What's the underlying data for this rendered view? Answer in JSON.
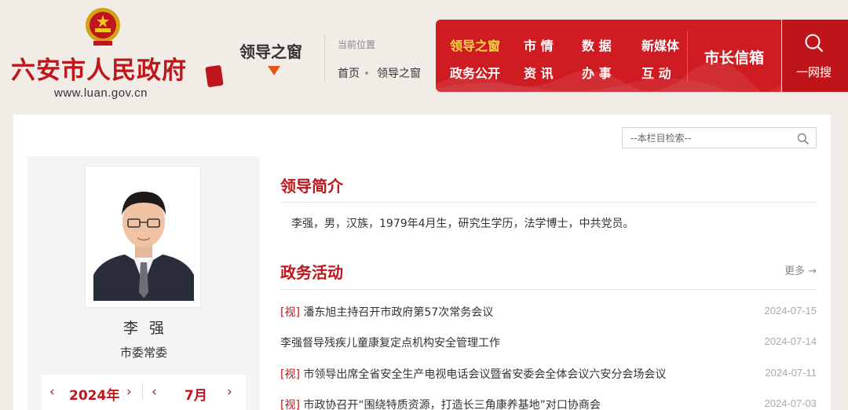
{
  "header": {
    "site_title": "六安市人民政府",
    "site_url": "www.luan.gov.cn",
    "section_name": "领导之窗",
    "current_position_label": "当前位置",
    "breadcrumb": {
      "home": "首页",
      "current": "领导之窗"
    }
  },
  "nav": {
    "items": [
      {
        "label": "领导之窗",
        "active": true
      },
      {
        "label": "市 情",
        "active": false
      },
      {
        "label": "数 据",
        "active": false
      },
      {
        "label": "新媒体",
        "active": false
      },
      {
        "label": "政务公开",
        "active": false
      },
      {
        "label": "资 讯",
        "active": false
      },
      {
        "label": "办 事",
        "active": false
      },
      {
        "label": "互 动",
        "active": false
      }
    ],
    "mayor_mailbox": "市长信箱",
    "search_label": "一网搜"
  },
  "column_search": {
    "placeholder": "--本栏目检索--"
  },
  "leader": {
    "name": "李强",
    "title": "市委常委"
  },
  "calendar": {
    "year": "2024年",
    "month": "7月"
  },
  "profile": {
    "heading": "领导简介",
    "text": "李强，男，汉族，1979年4月生，研究生学历，法学博士，中共党员。"
  },
  "activities": {
    "heading": "政务活动",
    "more": "更多",
    "items": [
      {
        "tag": "[视]",
        "title": "潘东旭主持召开市政府第57次常务会议",
        "date": "2024-07-15"
      },
      {
        "tag": "",
        "title": "李强督导残疾儿童康复定点机构安全管理工作",
        "date": "2024-07-14"
      },
      {
        "tag": "[视]",
        "title": "市领导出席全省安全生产电视电话会议暨省安委会全体会议六安分会场会议",
        "date": "2024-07-11"
      },
      {
        "tag": "[视]",
        "title": "市政协召开“围绕特质资源，打造长三角康养基地”对口协商会",
        "date": "2024-07-03"
      }
    ]
  },
  "colors": {
    "brand_red": "#c0151a",
    "nav_red": "#cf1c22",
    "active_nav": "#ffd44a"
  }
}
